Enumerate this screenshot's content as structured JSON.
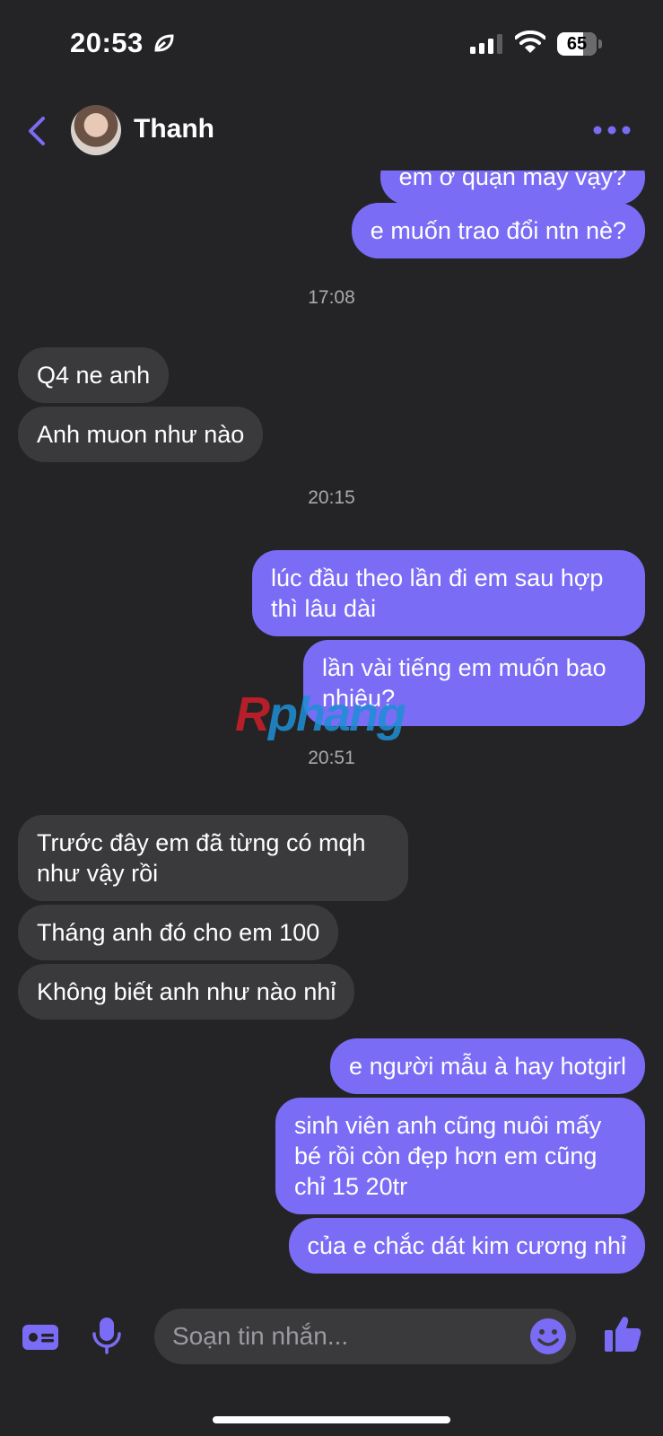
{
  "status_bar": {
    "time": "20:53",
    "battery": "65",
    "battery_level": 0.65,
    "icons": [
      "leaf-icon",
      "signal-icon",
      "wifi-icon",
      "battery-icon"
    ]
  },
  "header": {
    "contact_name": "Thanh",
    "icons": [
      "back-chevron-icon",
      "avatar",
      "more-dots-icon"
    ]
  },
  "messages": [
    {
      "side": "out",
      "text": "em ở quận mấy vậy?"
    },
    {
      "side": "out",
      "text": "e muốn trao đổi ntn nè?"
    },
    {
      "type": "time",
      "text": "17:08"
    },
    {
      "side": "in",
      "text": "Q4 ne anh"
    },
    {
      "side": "in",
      "text": "Anh muon như nào"
    },
    {
      "type": "time",
      "text": "20:15"
    },
    {
      "side": "out",
      "text": "lúc đầu theo lần đi em sau hợp thì lâu dài"
    },
    {
      "side": "out",
      "text": "lần vài tiếng em muốn bao nhiêu?"
    },
    {
      "type": "time",
      "text": "20:51"
    },
    {
      "side": "in",
      "text": "Trước đây em đã từng có mqh như vậy rồi"
    },
    {
      "side": "in",
      "text": "Tháng anh đó cho em 100"
    },
    {
      "side": "in",
      "text": "Không biết anh như nào nhỉ"
    },
    {
      "side": "out",
      "text": "e người mẫu à hay hotgirl"
    },
    {
      "side": "out",
      "text": "sinh viên anh cũng nuôi mấy bé rồi còn đẹp hơn em cũng chỉ 15 20tr"
    },
    {
      "side": "out",
      "text": "của e chắc dát kim cương nhỉ"
    }
  ],
  "watermark": {
    "first": "R",
    "rest": "phang"
  },
  "composer": {
    "placeholder": "Soạn tin nhắn...",
    "icons": [
      "contact-card-icon",
      "microphone-icon",
      "emoji-icon",
      "thumbs-up-icon"
    ]
  },
  "colors": {
    "background": "#242426",
    "outgoing_bubble": "#7b6cf6",
    "incoming_bubble": "#3a3a3c",
    "accent": "#7b6cf6"
  }
}
